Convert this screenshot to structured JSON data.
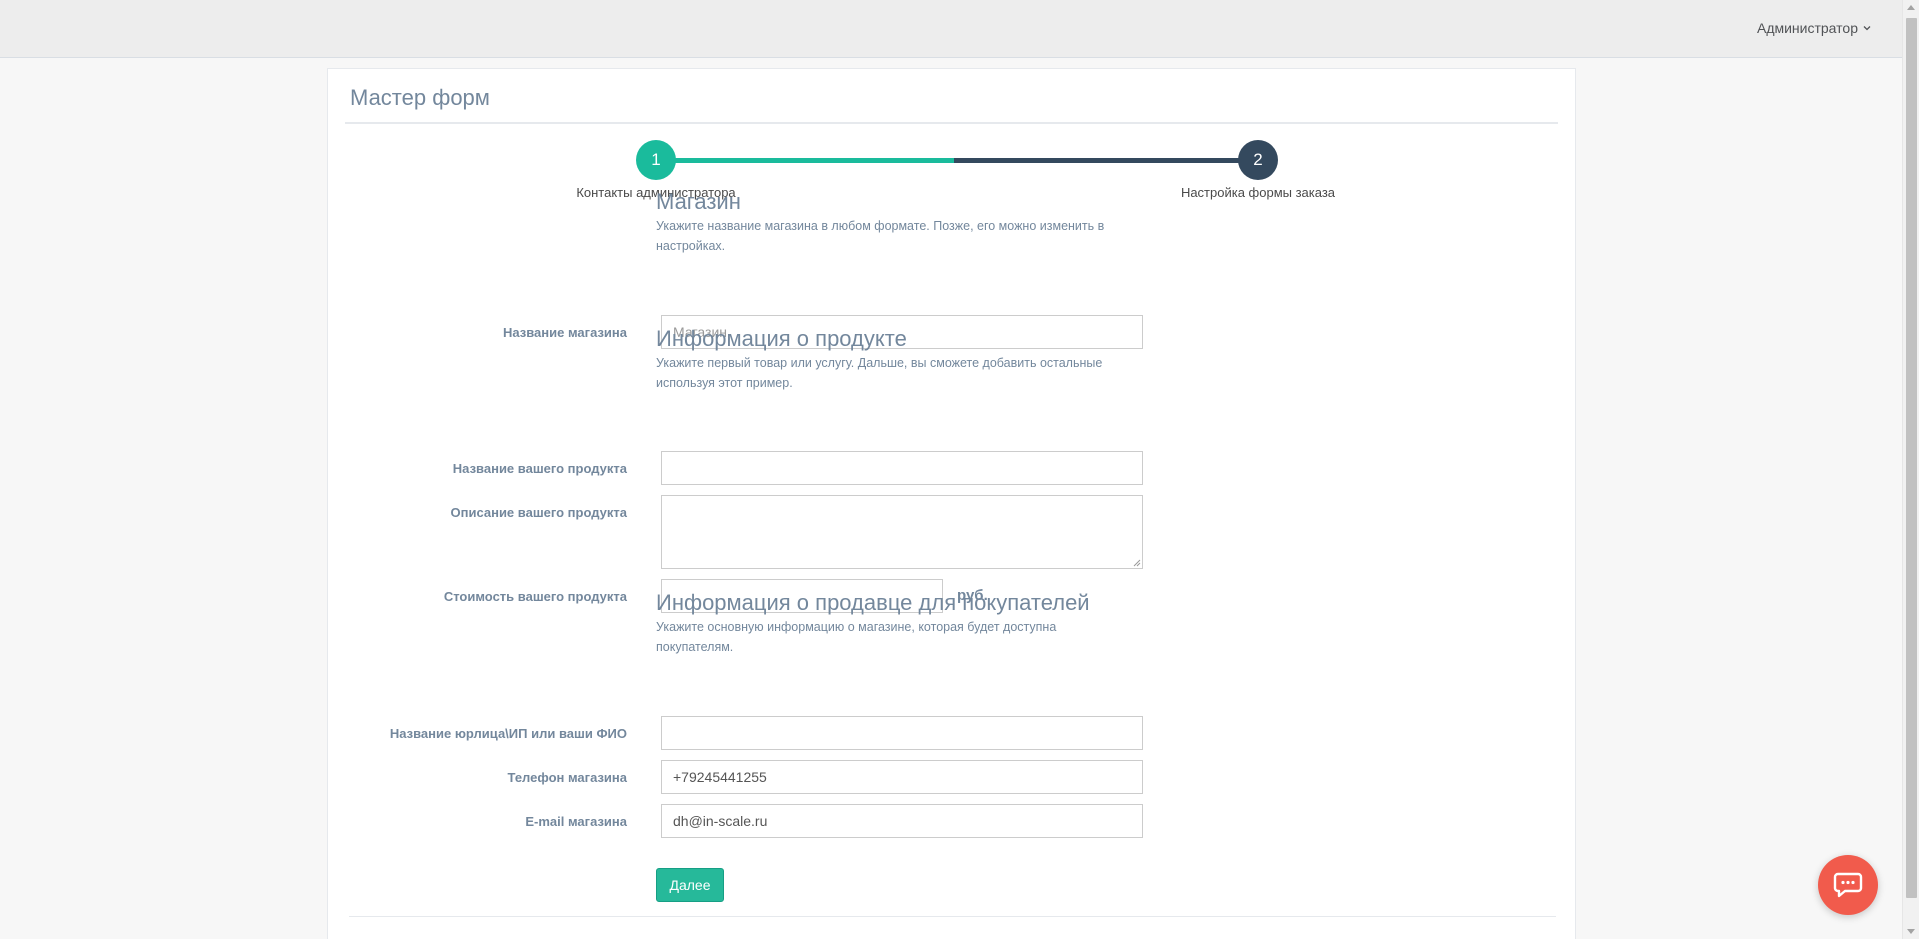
{
  "topbar": {
    "user_label": "Администратор"
  },
  "panel": {
    "title": "Мастер форм"
  },
  "wizard": {
    "steps": [
      {
        "number": "1",
        "label": "Контакты администратора",
        "state": "active"
      },
      {
        "number": "2",
        "label": "Настройка формы заказа",
        "state": "pending"
      }
    ],
    "progress_percent": 50
  },
  "form": {
    "store_section": {
      "heading": "Магазин",
      "help_line1": "Укажите название магазина в любом формате. Позже, его можно изменить в",
      "help_line2": "настройках.",
      "store_name": {
        "label": "Название магазина",
        "placeholder": "Магазин",
        "value": ""
      }
    },
    "product_section": {
      "heading": "Информация о продукте",
      "help_line1": "Укажите первый товар или услугу. Дальше, вы сможете добавить остальные",
      "help_line2": "используя этот пример.",
      "product_name": {
        "label": "Название вашего продукта",
        "value": ""
      },
      "product_description": {
        "label": "Описание вашего продукта",
        "value": ""
      },
      "product_price": {
        "label": "Стоимость вашего продукта",
        "value": "",
        "unit": "руб."
      }
    },
    "seller_section": {
      "heading": "Информация о продавце для покупателей",
      "help_line1": "Укажите основную информацию о магазине, которая будет доступна",
      "help_line2": "покупателям.",
      "legal_name": {
        "label": "Название юрлица\\ИП или ваши ФИО",
        "value": ""
      },
      "phone": {
        "label": "Телефон магазина",
        "value": "+79245441255"
      },
      "email": {
        "label": "E-mail магазина",
        "value": "dh@in-scale.ru"
      }
    },
    "next_button_label": "Далее"
  },
  "colors": {
    "accent": "#1abb9c",
    "step_pending": "#34495e",
    "chat_button": "#f15b4c",
    "text_muted": "#73879c"
  },
  "icons": {
    "user_menu_caret": "chevron-down-icon",
    "chat": "chat-bubble-icon"
  }
}
